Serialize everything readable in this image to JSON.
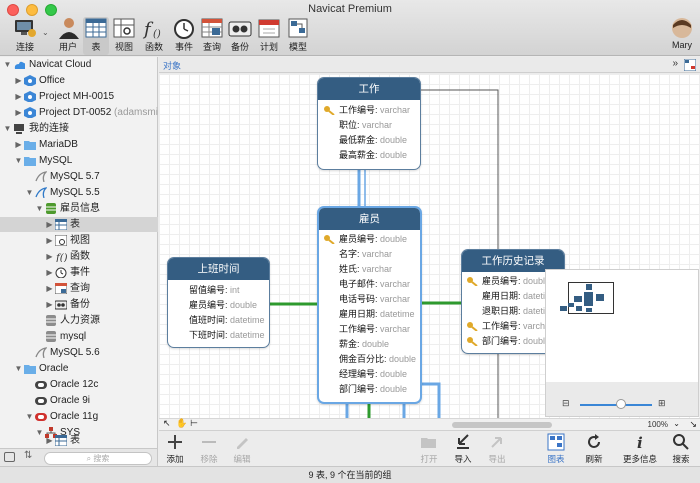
{
  "window": {
    "title": "Navicat Premium"
  },
  "toolbar": {
    "connect": "连接",
    "user": "用户",
    "table": "表",
    "view": "视图",
    "function": "函数",
    "event": "事件",
    "query": "查询",
    "backup": "备份",
    "schedule": "计划",
    "model": "模型",
    "account": "Mary"
  },
  "sidebar": {
    "items": [
      {
        "label": "Navicat Cloud"
      },
      {
        "label": "Office"
      },
      {
        "label": "Project MH-0015"
      },
      {
        "label": "Project DT-0052",
        "suffix": "(adamsmit..."
      },
      {
        "label": "我的连接"
      },
      {
        "label": "MariaDB"
      },
      {
        "label": "MySQL"
      },
      {
        "label": "MySQL 5.7"
      },
      {
        "label": "MySQL 5.5"
      },
      {
        "label": "雇员信息"
      },
      {
        "label": "表"
      },
      {
        "label": "视图"
      },
      {
        "label": "函数"
      },
      {
        "label": "事件"
      },
      {
        "label": "查询"
      },
      {
        "label": "备份"
      },
      {
        "label": "人力资源"
      },
      {
        "label": "mysql"
      },
      {
        "label": "MySQL 5.6"
      },
      {
        "label": "Oracle"
      },
      {
        "label": "Oracle 12c"
      },
      {
        "label": "Oracle 9i"
      },
      {
        "label": "Oracle 11g"
      },
      {
        "label": "SYS"
      },
      {
        "label": "表"
      }
    ],
    "search_placeholder": "搜索"
  },
  "main": {
    "tab": "对象",
    "zoom": "100%"
  },
  "diagram": {
    "gongzuo": {
      "title": "工作",
      "fields": [
        {
          "name": "工作编号",
          "type": "varchar"
        },
        {
          "name": "职位",
          "type": "varchar"
        },
        {
          "name": "最低薪金",
          "type": "double"
        },
        {
          "name": "最高薪金",
          "type": "double"
        }
      ]
    },
    "guyuan": {
      "title": "雇员",
      "fields": [
        {
          "name": "雇员编号",
          "type": "double"
        },
        {
          "name": "名字",
          "type": "varchar"
        },
        {
          "name": "姓氏",
          "type": "varchar"
        },
        {
          "name": "电子邮件",
          "type": "varchar"
        },
        {
          "name": "电话号码",
          "type": "varchar"
        },
        {
          "name": "雇用日期",
          "type": "datetime"
        },
        {
          "name": "工作编号",
          "type": "varchar"
        },
        {
          "name": "薪金",
          "type": "double"
        },
        {
          "name": "佣金百分比",
          "type": "double"
        },
        {
          "name": "经理编号",
          "type": "double"
        },
        {
          "name": "部门编号",
          "type": "double"
        }
      ]
    },
    "shangban": {
      "title": "上班时间",
      "fields": [
        {
          "name": "留值编号",
          "type": "int"
        },
        {
          "name": "雇员编号",
          "type": "double"
        },
        {
          "name": "值班时间",
          "type": "datetime"
        },
        {
          "name": "下班时间",
          "type": "datetime"
        }
      ]
    },
    "lishi": {
      "title": "工作历史记录",
      "fields": [
        {
          "name": "雇员编号",
          "type": "double"
        },
        {
          "name": "雇用日期",
          "type": "datetime"
        },
        {
          "name": "退职日期",
          "type": "datetime"
        },
        {
          "name": "工作编号",
          "type": "varchar"
        },
        {
          "name": "部门编号",
          "type": "double"
        }
      ]
    }
  },
  "bottombar": {
    "add": "添加",
    "remove": "移除",
    "edit": "编辑",
    "open": "打开",
    "import": "导入",
    "export": "导出",
    "diagram": "图表",
    "refresh": "刷新",
    "more_info": "更多信息",
    "search": "搜索"
  },
  "status": {
    "text": "9 表, 9 个在当前的组"
  },
  "colors": {
    "entity_header": "#345d82",
    "link_blue": "#6aa7e4",
    "link_green": "#2e9a2e",
    "accent": "#3a74c6"
  }
}
